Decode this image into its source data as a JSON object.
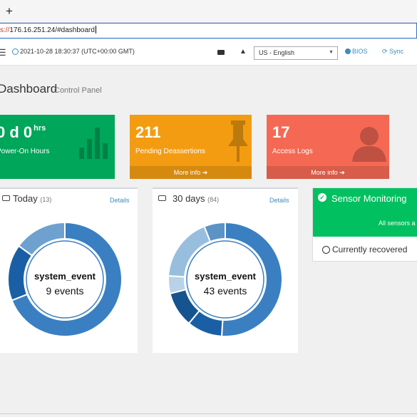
{
  "browser": {
    "new_tab": "+",
    "url_scheme": "s://",
    "url_rest": "176.16.251.24/#dashboard"
  },
  "topbar": {
    "datetime": "2021-10-28 18:30:37 (UTC+00:00 GMT)",
    "language": "US - English",
    "bios_label": "BIOS",
    "sync_label": "Sync"
  },
  "page": {
    "title": "Dashboard",
    "subtitle": "Control Panel"
  },
  "tiles": {
    "hours": {
      "value": "0 d 0",
      "unit": "hrs",
      "label": "Power-On Hours",
      "color": "#00a65a"
    },
    "pending": {
      "value": "211",
      "label": "Pending Deassertions",
      "footer": "More info ➔",
      "color": "#f39c12"
    },
    "access": {
      "value": "17",
      "label": "Access Logs",
      "footer": "More info ➔",
      "color": "#f56954"
    }
  },
  "today": {
    "title": "Today",
    "count": "(13)",
    "details": "Details",
    "center_label": "system_event",
    "center_value": "9 events",
    "segments": [
      {
        "fraction": 0.69,
        "color": "#3a7fc1"
      },
      {
        "fraction": 0.16,
        "color": "#1a5fa5"
      },
      {
        "fraction": 0.15,
        "color": "#6fa1d0"
      }
    ]
  },
  "days30": {
    "title": "30 days",
    "count": "(84)",
    "details": "Details",
    "center_label": "system_event",
    "center_value": "43 events",
    "segments": [
      {
        "fraction": 0.51,
        "color": "#3a7fc1"
      },
      {
        "fraction": 0.1,
        "color": "#1a5fa5"
      },
      {
        "fraction": 0.1,
        "color": "#15548f"
      },
      {
        "fraction": 0.05,
        "color": "#b8d2ea"
      },
      {
        "fraction": 0.18,
        "color": "#98bede"
      },
      {
        "fraction": 0.06,
        "color": "#5b93c6"
      }
    ]
  },
  "sensor": {
    "title": "Sensor Monitoring",
    "status": "All sensors a",
    "recovered": "Currently recovered"
  }
}
